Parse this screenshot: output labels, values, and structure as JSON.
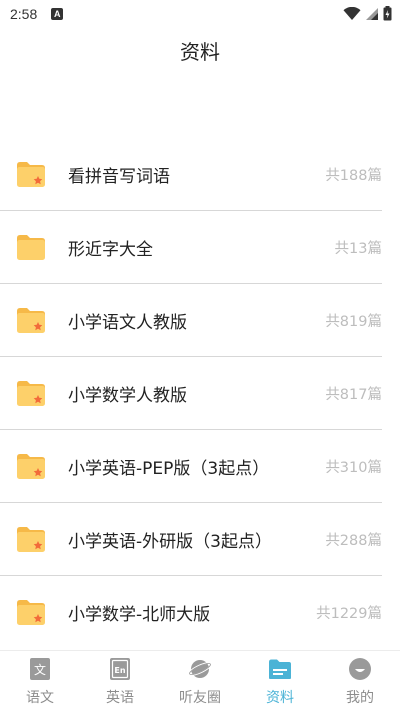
{
  "status": {
    "time": "2:58",
    "notification_badge": "A"
  },
  "header": {
    "title": "资料"
  },
  "items": [
    {
      "label": "看拼音写词语",
      "count": "共188篇",
      "icon": "folder-star-icon"
    },
    {
      "label": "形近字大全",
      "count": "共13篇",
      "icon": "folder-icon"
    },
    {
      "label": "小学语文人教版",
      "count": "共819篇",
      "icon": "folder-star-icon"
    },
    {
      "label": "小学数学人教版",
      "count": "共817篇",
      "icon": "folder-star-icon"
    },
    {
      "label": "小学英语-PEP版（3起点）",
      "count": "共310篇",
      "icon": "folder-star-icon"
    },
    {
      "label": "小学英语-外研版（3起点）",
      "count": "共288篇",
      "icon": "folder-star-icon"
    },
    {
      "label": "小学数学-北师大版",
      "count": "共1229篇",
      "icon": "folder-star-icon"
    }
  ],
  "tabs": [
    {
      "label": "语文",
      "icon": "chinese-book-icon",
      "active": false
    },
    {
      "label": "英语",
      "icon": "english-book-icon",
      "active": false
    },
    {
      "label": "听友圈",
      "icon": "planet-icon",
      "active": false
    },
    {
      "label": "资料",
      "icon": "folder-tab-icon",
      "active": true
    },
    {
      "label": "我的",
      "icon": "profile-icon",
      "active": false
    }
  ],
  "colors": {
    "accent": "#4bb3d6",
    "folder": "#fdd06a",
    "folder_tab": "#f6b948",
    "star": "#f26b3a",
    "inactive": "#8d8d8d"
  }
}
